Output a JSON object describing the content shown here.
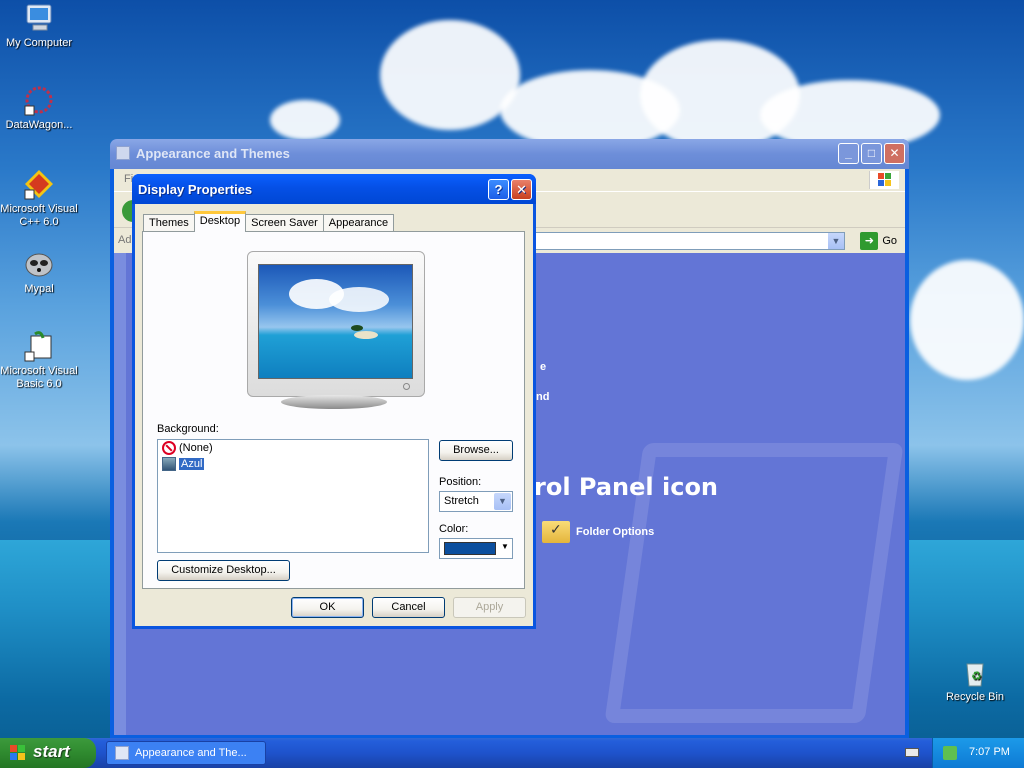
{
  "desktop": {
    "icons": [
      {
        "label": "My Computer"
      },
      {
        "label": "DataWagon..."
      },
      {
        "label": "Microsoft Visual C++ 6.0"
      },
      {
        "label": "Mypal"
      },
      {
        "label": "Microsoft Visual Basic 6.0"
      },
      {
        "label": "Recycle Bin"
      }
    ]
  },
  "explorer": {
    "title": "Appearance and Themes",
    "menu_fragment": "Fi",
    "address_fragment": "Ad",
    "go_label": "Go",
    "content": {
      "big_label_fragment": "rol Panel icon",
      "fragment_1": "e",
      "fragment_2": "nd",
      "folder_options": "Folder Options"
    }
  },
  "dialog": {
    "title": "Display Properties",
    "help_label": "?",
    "close_label": "✕",
    "tabs": [
      {
        "label": "Themes",
        "active": false
      },
      {
        "label": "Desktop",
        "active": true
      },
      {
        "label": "Screen Saver",
        "active": false
      },
      {
        "label": "Appearance",
        "active": false
      }
    ],
    "background_label": "Background:",
    "backgrounds": [
      {
        "label": "(None)",
        "icon": "none-icon",
        "selected": false
      },
      {
        "label": "Azul",
        "icon": "image-icon",
        "selected": true
      }
    ],
    "browse_label": "Browse...",
    "position_label": "Position:",
    "position_value": "Stretch",
    "color_label": "Color:",
    "color_value": "#0b4f9e",
    "customize_label": "Customize Desktop...",
    "ok_label": "OK",
    "cancel_label": "Cancel",
    "apply_label": "Apply"
  },
  "taskbar": {
    "start_label": "start",
    "task_label": "Appearance and The...",
    "clock": "7:07 PM"
  }
}
